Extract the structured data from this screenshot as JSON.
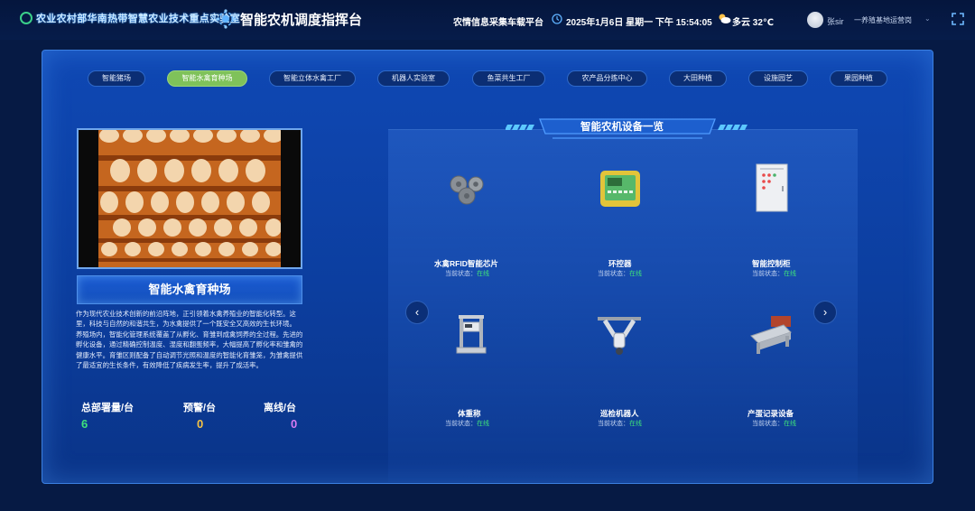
{
  "header": {
    "org_name": "农业农村部华南热带智慧农业技术重点实验室",
    "app_title": "智能农机调度指挥台",
    "platform": "农情信息采集车载平台",
    "datetime": "2025年1月6日 星期一 下午 15:54:05",
    "weather": "多云 32℃",
    "user_name": "张sir",
    "user_role": "一养殖基地运营岗"
  },
  "tabs": [
    {
      "label": "智能猪场",
      "active": false
    },
    {
      "label": "智能水禽育种场",
      "active": true
    },
    {
      "label": "智能立体水禽工厂",
      "active": false
    },
    {
      "label": "机器人实验室",
      "active": false
    },
    {
      "label": "鱼菜共生工厂",
      "active": false
    },
    {
      "label": "农产品分拣中心",
      "active": false
    },
    {
      "label": "大田种植",
      "active": false
    },
    {
      "label": "设施园艺",
      "active": false
    },
    {
      "label": "果园种植",
      "active": false
    }
  ],
  "farm": {
    "title": "智能水禽育种场",
    "description": [
      "作为现代农业技术创新的前沿阵地，正引领着水禽养殖业的智能化转型。这里，科技与自然的和谐共生，为水禽提供了一个既安全又高效的生长环境。",
      "养殖场内，智能化管理系统覆盖了从孵化、育雏到成禽饲养的全过程。先进的孵化设备，通过精确控制温度、湿度和翻蛋频率，大幅提高了孵化率和雏禽的健康水平。育雏区则配备了自动调节光照和温度的智能化育雏笼，为雏禽提供了最适宜的生长条件，有效降低了疾病发生率，提升了成活率。"
    ],
    "stats": [
      {
        "label": "总部署量/台",
        "value": "6",
        "color": "#3fe27b"
      },
      {
        "label": "预警/台",
        "value": "0",
        "color": "#f6c344"
      },
      {
        "label": "离线/台",
        "value": "0",
        "color": "#d77bf2"
      }
    ]
  },
  "equipment": {
    "title": "智能农机设备一览",
    "status_label": "当前状态：",
    "devices": [
      {
        "name": "水禽RFID智能芯片",
        "status": "在线"
      },
      {
        "name": "环控器",
        "status": "在线"
      },
      {
        "name": "智能控制柜",
        "status": "在线"
      },
      {
        "name": "体重称",
        "status": "在线"
      },
      {
        "name": "巡检机器人",
        "status": "在线"
      },
      {
        "name": "产蛋记录设备",
        "status": "在线"
      }
    ],
    "prev_glyph": "‹",
    "next_glyph": "›"
  },
  "colors": {
    "accent_green": "#7fc25a",
    "online": "#3fe27b",
    "panel_blue": "#0f48b4"
  }
}
